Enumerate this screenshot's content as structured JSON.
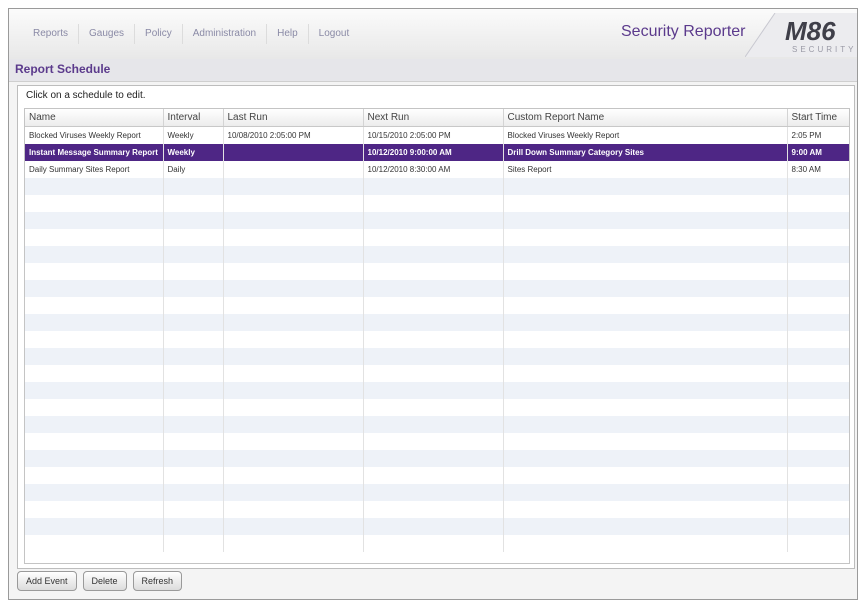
{
  "nav": {
    "items": [
      "Reports",
      "Gauges",
      "Policy",
      "Administration",
      "Help",
      "Logout"
    ]
  },
  "app": {
    "title": "Security Reporter"
  },
  "logo": {
    "main": "M86",
    "sub": "SECURITY"
  },
  "page": {
    "title": "Report Schedule",
    "instruction": "Click on a schedule to edit."
  },
  "table": {
    "headers": [
      "Name",
      "Interval",
      "Last Run",
      "Next Run",
      "Custom Report Name",
      "Start Time"
    ],
    "rows": [
      {
        "name": "Blocked Viruses Weekly Report",
        "interval": "Weekly",
        "last_run": "10/08/2010 2:05:00 PM",
        "next_run": "10/15/2010 2:05:00 PM",
        "custom_report_name": "Blocked Viruses Weekly Report",
        "start_time": "2:05 PM"
      },
      {
        "name": "Instant Message Summary Report",
        "interval": "Weekly",
        "last_run": "",
        "next_run": "10/12/2010 9:00:00 AM",
        "custom_report_name": "Drill Down Summary Category Sites",
        "start_time": "9:00 AM"
      },
      {
        "name": "Daily Summary Sites Report",
        "interval": "Daily",
        "last_run": "",
        "next_run": "10/12/2010 8:30:00 AM",
        "custom_report_name": "Sites Report",
        "start_time": "8:30 AM"
      }
    ],
    "selected_index": 1
  },
  "buttons": {
    "add_event": "Add Event",
    "delete": "Delete",
    "refresh": "Refresh"
  },
  "colors": {
    "accent": "#5b3a8c",
    "selected_row": "#4e2685",
    "alt_row": "#eef2f8"
  }
}
